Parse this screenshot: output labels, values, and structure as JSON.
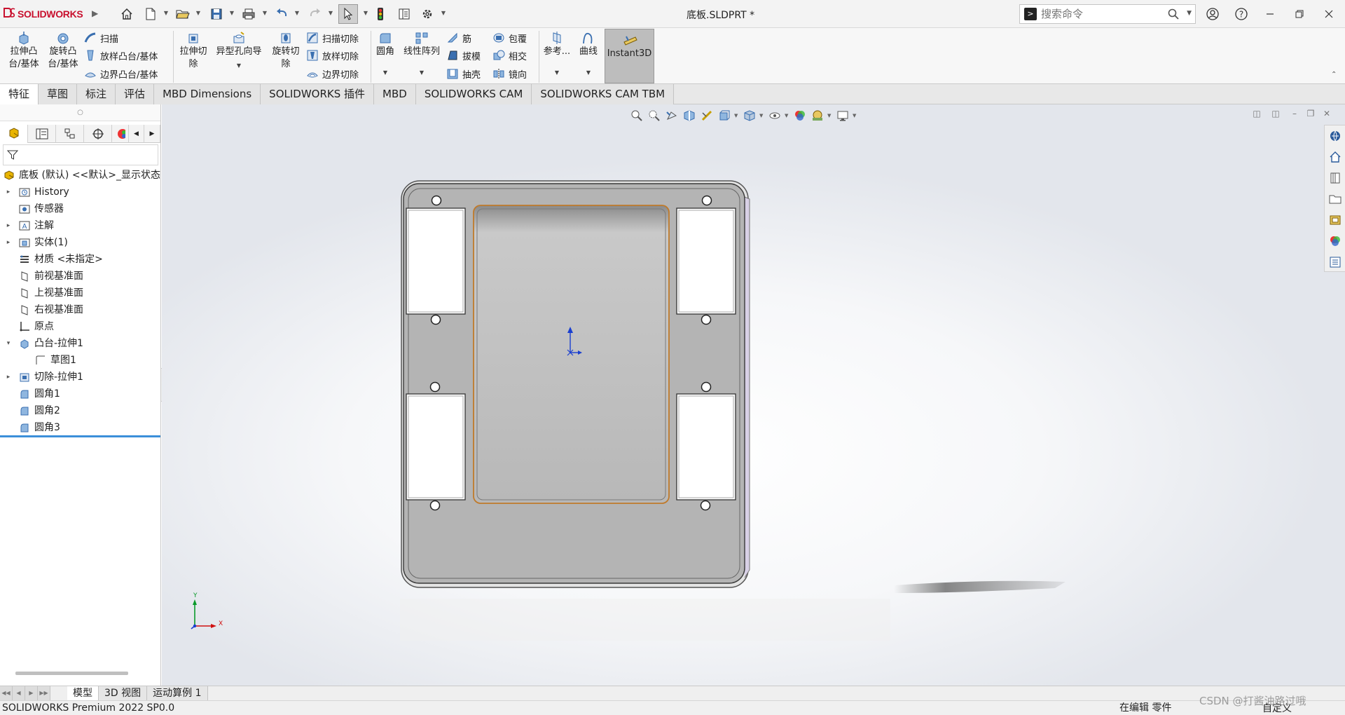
{
  "app": {
    "brand": "SOLIDWORKS",
    "document_title": "底板.SLDPRT *"
  },
  "search": {
    "placeholder": "搜索命令"
  },
  "ribbon": {
    "extrude_boss": "拉伸凸\n台/基体",
    "revolve_boss": "旋转凸\n台/基体",
    "sweep": "扫描",
    "loft_boss": "放样凸台/基体",
    "boundary_boss": "边界凸台/基体",
    "extrude_cut": "拉伸切\n除",
    "hole_wizard": "异型孔向导",
    "revolve_cut": "旋转切\n除",
    "sweep_cut": "扫描切除",
    "loft_cut": "放样切除",
    "boundary_cut": "边界切除",
    "fillet": "圆角",
    "linear_pattern": "线性阵列",
    "rib": "筋",
    "draft": "拔模",
    "shell": "抽壳",
    "wrap": "包覆",
    "intersect": "相交",
    "mirror": "镜向",
    "reference": "参考...",
    "curves": "曲线",
    "instant3d": "Instant3D"
  },
  "tabs": [
    "特征",
    "草图",
    "标注",
    "评估",
    "MBD Dimensions",
    "SOLIDWORKS 插件",
    "MBD",
    "SOLIDWORKS CAM",
    "SOLIDWORKS CAM TBM"
  ],
  "tree": {
    "root": "底板 (默认) <<默认>_显示状态",
    "items": [
      "History",
      "传感器",
      "注解",
      "实体(1)",
      "材质 <未指定>",
      "前视基准面",
      "上视基准面",
      "右视基准面",
      "原点",
      "凸台-拉伸1",
      "草图1",
      "切除-拉伸1",
      "圆角1",
      "圆角2",
      "圆角3"
    ]
  },
  "triad": {
    "x_label": "X",
    "y_label": "Y"
  },
  "bottom_tabs": [
    "模型",
    "3D 视图",
    "运动算例 1"
  ],
  "status": {
    "product": "SOLIDWORKS Premium 2022 SP0.0",
    "mode": "在编辑 零件",
    "units": "自定义"
  },
  "watermark": "CSDN @打酱油路过哦",
  "colors": {
    "brand_red": "#c8102e",
    "rollback_bar": "#3c8fd9",
    "model_gray": "#b4b4b4",
    "pocket_edge": "#c07a2a"
  }
}
